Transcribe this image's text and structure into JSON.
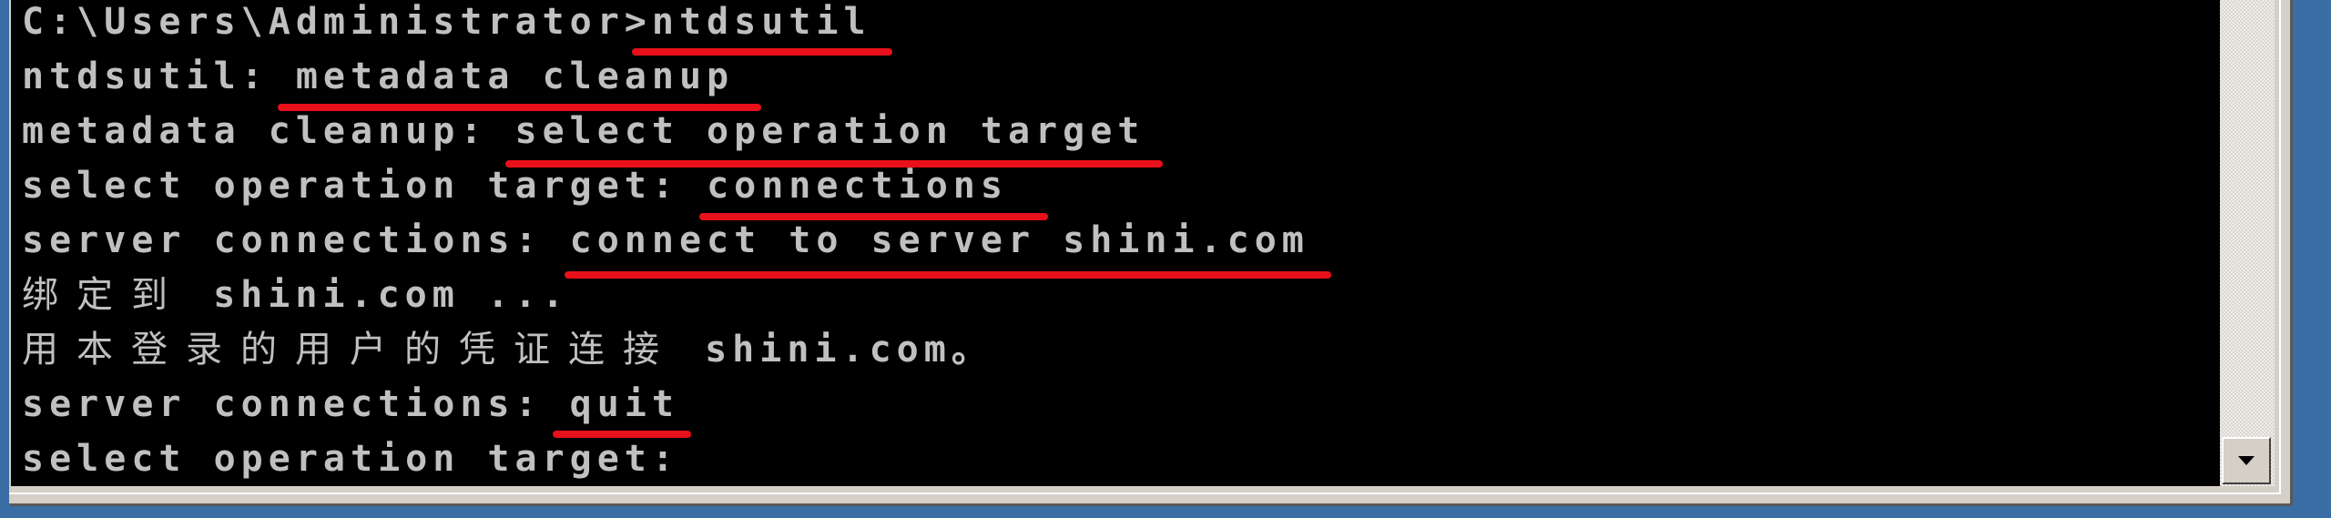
{
  "console": {
    "lines": [
      {
        "prompt": "C:\\Users\\Administrator>",
        "cjk": "",
        "command": "ntdsutil"
      },
      {
        "prompt": "ntdsutil: ",
        "cjk": "",
        "command": "metadata cleanup"
      },
      {
        "prompt": "metadata cleanup: ",
        "cjk": "",
        "command": "select operation target"
      },
      {
        "prompt": "select operation target: ",
        "cjk": "",
        "command": "connections"
      },
      {
        "prompt": "server connections: ",
        "cjk": "",
        "command": "connect to server shini.com"
      },
      {
        "prompt": "",
        "cjk": "绑定到",
        "command": " shini.com ..."
      },
      {
        "prompt": "",
        "cjk": "用本登录的用户的凭证连接",
        "command": " shini.com。"
      },
      {
        "prompt": "server connections: ",
        "cjk": "",
        "command": "quit"
      },
      {
        "prompt": "select operation target:",
        "cjk": "",
        "command": ""
      }
    ],
    "text_color": "#c0c0c0",
    "background_color": "#000000",
    "annotation_color": "#e8101a"
  },
  "scrollbar": {
    "down_icon": "triangle-down"
  }
}
